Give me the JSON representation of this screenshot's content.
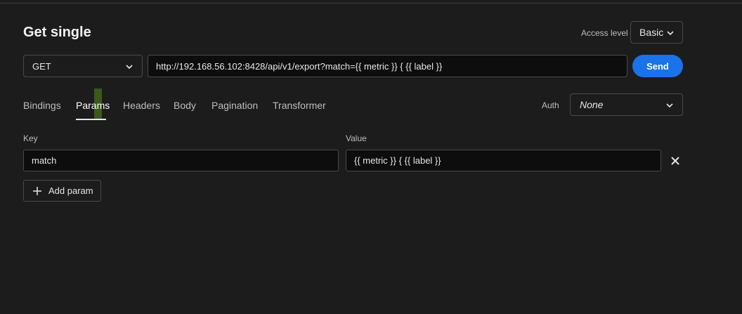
{
  "header": {
    "title": "Get single",
    "access_level_label": "Access level",
    "access_level_value": "Basic"
  },
  "request": {
    "method": "GET",
    "url": "http://192.168.56.102:8428/api/v1/export?match={{ metric }} { {{ label }}",
    "send_label": "Send"
  },
  "tabs": [
    {
      "label": "Bindings"
    },
    {
      "label": "Params"
    },
    {
      "label": "Headers"
    },
    {
      "label": "Body"
    },
    {
      "label": "Pagination"
    },
    {
      "label": "Transformer"
    }
  ],
  "active_tab": "Params",
  "auth": {
    "label": "Auth",
    "value": "None"
  },
  "params": {
    "key_label": "Key",
    "value_label": "Value",
    "rows": [
      {
        "key": "match",
        "value": "{{ metric }} { {{ label }}"
      }
    ],
    "add_label": "Add param"
  },
  "icons": {
    "chevron": "chevron-down-icon",
    "remove": "close-icon",
    "add": "plus-icon"
  },
  "colors": {
    "background": "#1c1c1c",
    "accent": "#1a73e8"
  }
}
